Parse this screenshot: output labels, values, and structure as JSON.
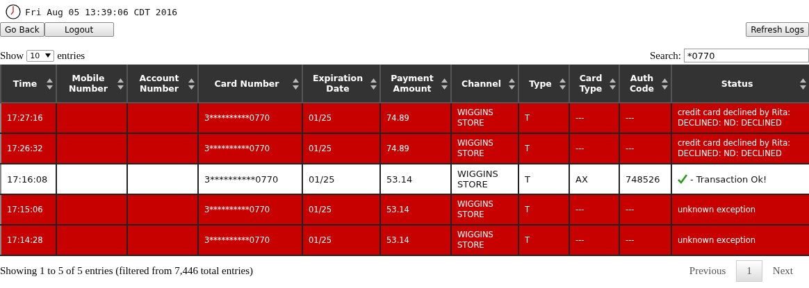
{
  "clock": {
    "datetime": "Fri Aug 05 13:39:06 CDT 2016"
  },
  "buttons": {
    "back": "Go Back",
    "logout": "Logout",
    "refresh": "Refresh Logs"
  },
  "length": {
    "before": "Show",
    "value": "10",
    "after": "entries"
  },
  "search": {
    "label": "Search:",
    "value": "*0770"
  },
  "table": {
    "columns": [
      "Time",
      "Mobile Number",
      "Account Number",
      "Card Number",
      "Expiration Date",
      "Payment Amount",
      "Channel",
      "Type",
      "Card Type",
      "Auth Code",
      "Status"
    ],
    "rows": [
      {
        "kind": "error",
        "cells": [
          "17:27:16",
          "",
          "",
          "3**********0770",
          "01/25",
          "74.89",
          "WIGGINS STORE",
          "T",
          "---",
          "---",
          "credit card declined by Rita: DECLINED: ND: DECLINED"
        ]
      },
      {
        "kind": "error",
        "cells": [
          "17:26:32",
          "",
          "",
          "3**********0770",
          "01/25",
          "74.89",
          "WIGGINS STORE",
          "T",
          "---",
          "---",
          "credit card declined by Rita: DECLINED: ND: DECLINED"
        ]
      },
      {
        "kind": "ok",
        "cells": [
          "17:16:08",
          "",
          "",
          "3**********0770",
          "01/25",
          "53.14",
          "WIGGINS STORE",
          "T",
          "AX",
          "748526",
          "- Transaction Ok!"
        ]
      },
      {
        "kind": "error",
        "cells": [
          "17:15:06",
          "",
          "",
          "3**********0770",
          "01/25",
          "53.14",
          "WIGGINS STORE",
          "T",
          "---",
          "---",
          "unknown exception"
        ]
      },
      {
        "kind": "error",
        "cells": [
          "17:14:28",
          "",
          "",
          "3**********0770",
          "01/25",
          "53.14",
          "WIGGINS STORE",
          "T",
          "---",
          "---",
          "unknown exception"
        ]
      }
    ]
  },
  "info": "Showing 1 to 5 of 5 entries (filtered from 7,446 total entries)",
  "pagination": [
    {
      "label": "Previous",
      "selected": false
    },
    {
      "label": "1",
      "selected": true
    },
    {
      "label": "Next",
      "selected": false
    }
  ]
}
